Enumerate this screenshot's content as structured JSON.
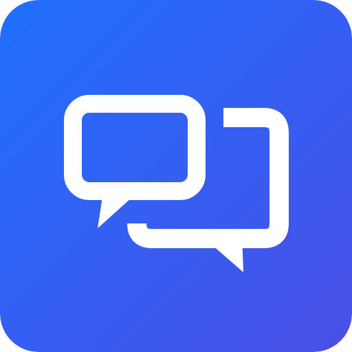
{
  "icon": {
    "name": "chat-bubbles-icon",
    "colors": {
      "gradient_start": "#1f6ffe",
      "gradient_end": "#4a4fe6",
      "glyph": "#ffffff"
    }
  }
}
